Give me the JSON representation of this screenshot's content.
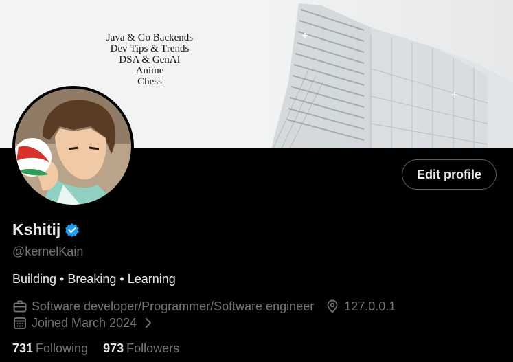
{
  "banner": {
    "lines": [
      "Java & Go Backends",
      "Dev Tips & Trends",
      "DSA & GenAI",
      "Anime",
      "Chess"
    ]
  },
  "profile": {
    "display_name": "Kshitij",
    "handle": "@kernelKain",
    "bio": "Building • Breaking • Learning",
    "profession": "Software developer/Programmer/Software engineer",
    "location": "127.0.0.1",
    "joined": "Joined March 2024",
    "following_count": "731",
    "following_label": "Following",
    "followers_count": "973",
    "followers_label": "Followers"
  },
  "actions": {
    "edit_profile_label": "Edit profile"
  },
  "colors": {
    "background": "#000000",
    "text": "#e7e9ea",
    "muted": "#71767b",
    "verified": "#1d9bf0",
    "border": "#536471"
  },
  "icons": {
    "verified": "verified-badge-icon",
    "profession": "briefcase-icon",
    "location": "location-pin-icon",
    "joined": "calendar-icon",
    "chevron": "chevron-right-icon"
  }
}
